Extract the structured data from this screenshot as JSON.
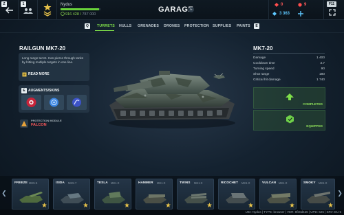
{
  "topbar": {
    "back_key": "Z",
    "friends_key": "1",
    "player": {
      "name": "Nydus",
      "xp_current": "916 428",
      "xp_max": "787 000",
      "xp_progress": 0.97
    },
    "title": "GARAGE",
    "title_key": "E",
    "currency": [
      {
        "name": "rubies",
        "value": "0",
        "color": "#ff4d4d"
      },
      {
        "name": "tankoins",
        "value": "9",
        "color": "#ff4d4d"
      },
      {
        "name": "crystals",
        "value": "3 363",
        "color": "#5ec8ff"
      }
    ],
    "fullscreen_key": "F11"
  },
  "tabs": {
    "left_key": "Q",
    "right_key": "E",
    "items": [
      {
        "label": "TURRETS",
        "active": true
      },
      {
        "label": "HULLS"
      },
      {
        "label": "GRENADES"
      },
      {
        "label": "DRONES"
      },
      {
        "label": "PROTECTION"
      },
      {
        "label": "SUPPLIES"
      },
      {
        "label": "PAINTS"
      }
    ]
  },
  "item": {
    "title": "RAILGUN MK7-20",
    "description": "Long range turret. Can pierce through tanks by hitting multiple targets in one line.",
    "read_more": "READ MORE",
    "augments_key": "E",
    "augments_title": "AUGMENTS/SKINS",
    "protection_label": "PROTECTION MODULE",
    "protection_name": "FALCON"
  },
  "stats": {
    "title": "MK7-20",
    "rows": [
      {
        "label": "Damage",
        "value": "1 400"
      },
      {
        "label": "Cooldown time",
        "value": "3.7"
      },
      {
        "label": "Turning speed",
        "value": "90"
      },
      {
        "label": "Shot range",
        "value": "180"
      },
      {
        "label": "Critical hit damage",
        "value": "1 740"
      }
    ],
    "upgrade_label": "COMPLETED",
    "equip_label": "EQUIPPED"
  },
  "turrets": [
    {
      "name": "FREEZE",
      "mk": "MK5-5"
    },
    {
      "name": "ISIDA",
      "mk": "MK5-7"
    },
    {
      "name": "TESLA",
      "mk": "MK1-0"
    },
    {
      "name": "HAMMER",
      "mk": "MK1-0"
    },
    {
      "name": "TWINS",
      "mk": "MK1-0"
    },
    {
      "name": "RICOCHET",
      "mk": "MK1-0"
    },
    {
      "name": "VULCAN",
      "mk": "MK1-0"
    },
    {
      "name": "SMOKY",
      "mk": "MK1-0"
    }
  ],
  "footer": "UID: Nydus | TYPE: browser | VER: 8f40d426 | UPD: 626 | SRV: EU 5"
}
